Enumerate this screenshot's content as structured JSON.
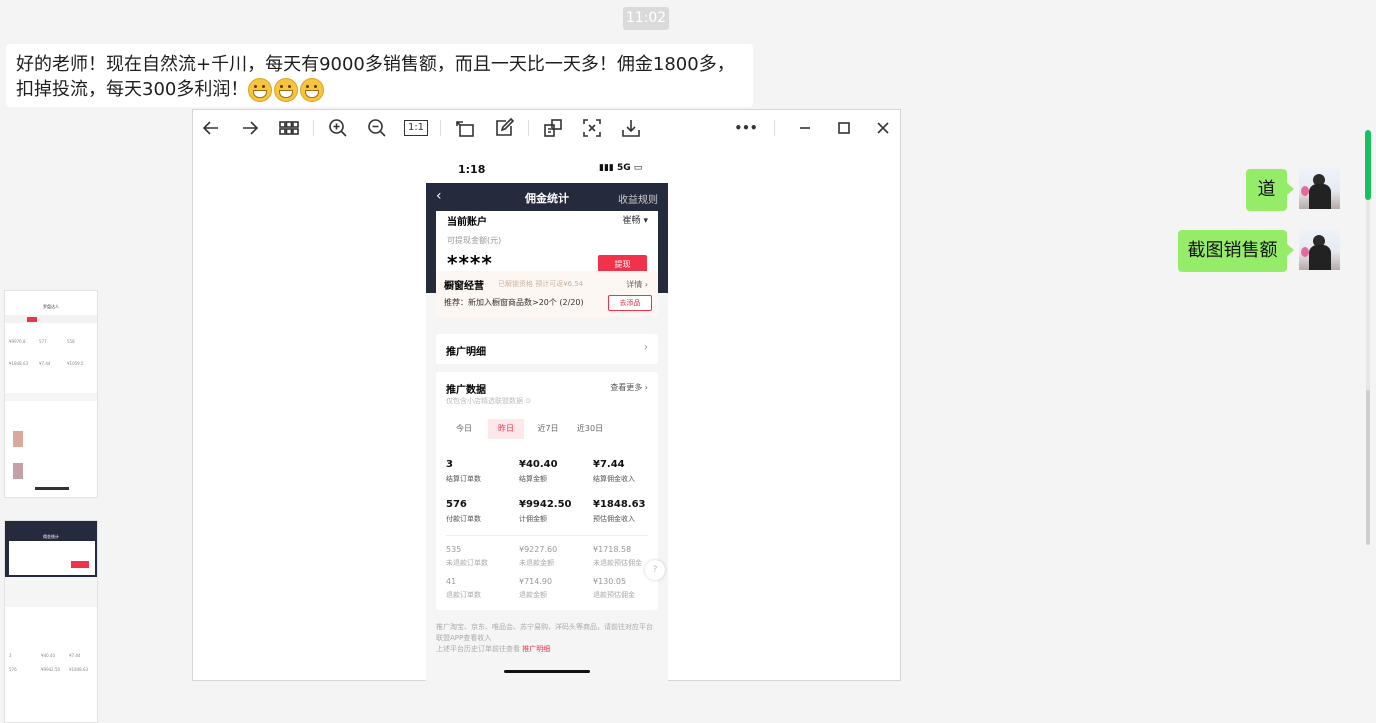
{
  "chat": {
    "timestamp": "11:02",
    "incoming_message": "好的老师！现在自然流+千川，每天有9000多销售额，而且一天比一天多！佣金1800多，扣掉投流，每天300多利润！",
    "incoming_emoji": "grinning-face-emoji",
    "outgoing": [
      {
        "text": "道"
      },
      {
        "text": "截图销售额"
      }
    ]
  },
  "viewer": {
    "toolbar_icons": [
      "back-arrow-icon",
      "forward-arrow-icon",
      "grid-icon",
      "zoom-in-icon",
      "zoom-out-icon",
      "actual-size-icon",
      "rotate-icon",
      "edit-icon",
      "ocr-icon",
      "screenshot-icon",
      "download-icon",
      "more-icon",
      "minimize-icon",
      "maximize-icon",
      "close-icon"
    ],
    "actual_size_label": "1:1",
    "more_label": "•••"
  },
  "phone": {
    "status_time": "1:18",
    "status_signal": "5G",
    "header_title": "佣金统计",
    "header_right": "收益规则",
    "account_label": "当前账户",
    "account_name": "崔畅 ▾",
    "withdraw_label": "可提现金额(元)",
    "withdraw_amount": "****",
    "withdraw_button": "提现",
    "shop_title": "橱窗经营",
    "shop_sub": "已解锁资格 预计可返¥6.54",
    "shop_detail": "详情 ›",
    "shop_tip": "推荐：新加入橱窗商品数>20个 (2/20)",
    "shop_button": "去添品",
    "promo_detail": "推广明细",
    "data_title": "推广数据",
    "data_more": "查看更多 ›",
    "data_sub": "仅包含小店精选联盟数据 ⊙",
    "tabs": [
      "今日",
      "昨日",
      "近7日",
      "近30日"
    ],
    "active_tab": "昨日",
    "stats_main": [
      {
        "value": "3",
        "label": "结算订单数"
      },
      {
        "value": "¥40.40",
        "label": "结算金额"
      },
      {
        "value": "¥7.44",
        "label": "结算佣金收入"
      },
      {
        "value": "576",
        "label": "付款订单数"
      },
      {
        "value": "¥9942.50",
        "label": "计佣金额"
      },
      {
        "value": "¥1848.63",
        "label": "预估佣金收入"
      }
    ],
    "stats_sub": [
      {
        "value": "535",
        "label": "未退款订单数"
      },
      {
        "value": "¥9227.60",
        "label": "未退款金额"
      },
      {
        "value": "¥1718.58",
        "label": "未退款预估佣金"
      },
      {
        "value": "41",
        "label": "退款订单数"
      },
      {
        "value": "¥714.90",
        "label": "退款金额"
      },
      {
        "value": "¥130.05",
        "label": "退款预估佣金"
      }
    ],
    "footer_text": "推广淘宝、京东、唯品会、苏宁易购、洋码头等商品，请前往对应平台联盟APP查看收入",
    "footer_link_prefix": "上述平台历史订单前往查看",
    "footer_link": "推广明细",
    "help_mark": "?"
  },
  "thumbnails": {
    "thumb1_title": "罗盘达人",
    "thumb1_values": [
      "¥9976.8",
      "577",
      "558",
      "¥1848.63",
      "¥7.44",
      "¥1059.5"
    ],
    "thumb2_title": "佣金统计",
    "thumb2_values": [
      "3",
      "¥40.40",
      "¥7.44",
      "576",
      "¥9942.50",
      "¥1848.63"
    ]
  },
  "colors": {
    "outgoing_bubble": "#95ec69",
    "phone_header": "#262a3d",
    "accent_red": "#f0324b",
    "scroll_green": "#17c15f"
  }
}
